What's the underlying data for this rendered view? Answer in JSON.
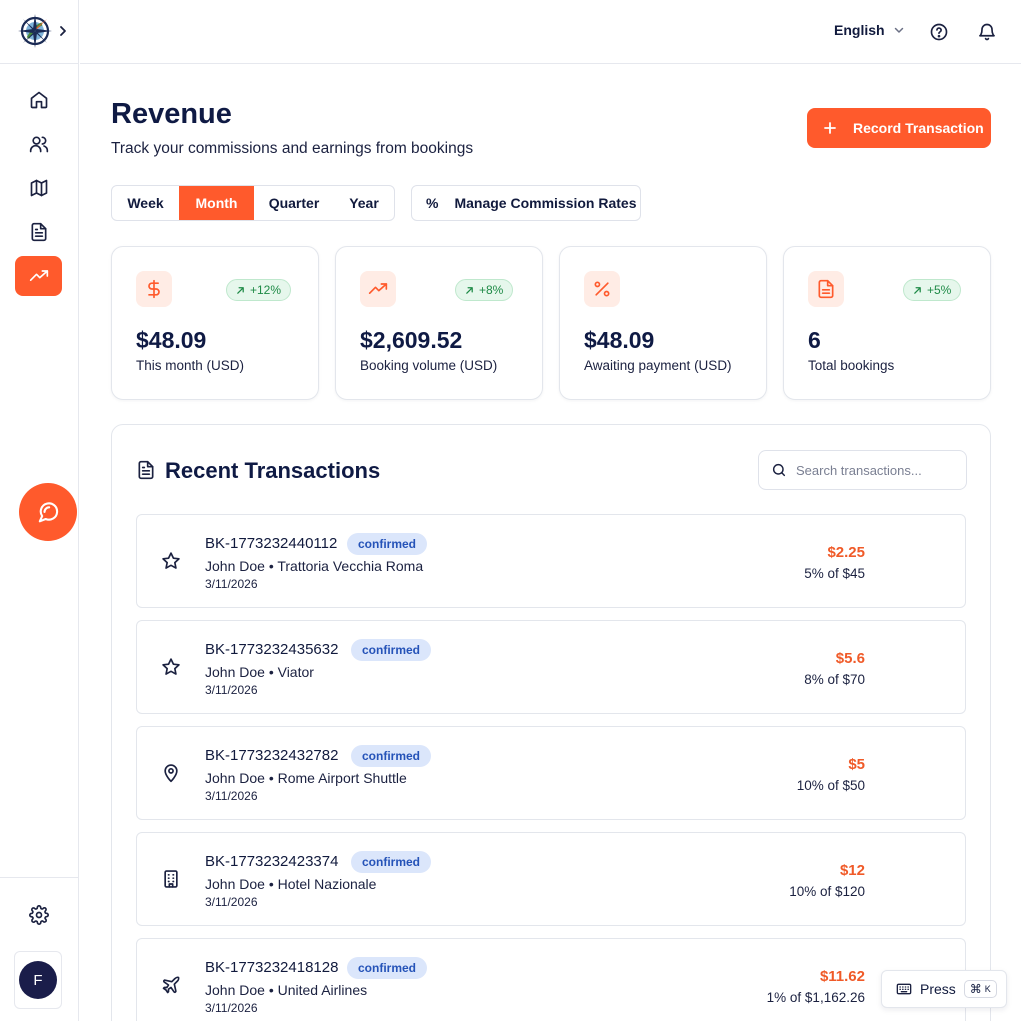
{
  "topbar": {
    "language": "English"
  },
  "header": {
    "title": "Revenue",
    "subtitle": "Track your commissions and earnings from bookings",
    "record_button": "Record Transaction"
  },
  "period_tabs": [
    {
      "label": "Week",
      "active": false
    },
    {
      "label": "Month",
      "active": true
    },
    {
      "label": "Quarter",
      "active": false
    },
    {
      "label": "Year",
      "active": false
    }
  ],
  "manage_button": {
    "icon_glyph": "%",
    "label": "Manage Commission Rates"
  },
  "stats": [
    {
      "icon": "dollar-icon",
      "badge": "+12%",
      "value": "$48.09",
      "label": "This month (USD)"
    },
    {
      "icon": "trending-up-icon",
      "badge": "+8%",
      "value": "$2,609.52",
      "label": "Booking volume (USD)"
    },
    {
      "icon": "percent-icon",
      "badge": "",
      "value": "$48.09",
      "label": "Awaiting payment (USD)"
    },
    {
      "icon": "document-icon",
      "badge": "+5%",
      "value": "6",
      "label": "Total bookings"
    }
  ],
  "transactions": {
    "title": "Recent Transactions",
    "search_placeholder": "Search transactions...",
    "rows": [
      {
        "icon": "star-icon",
        "id": "BK-1773232440112",
        "status": "confirmed",
        "desc": "John Doe • Trattoria Vecchia Roma",
        "date": "3/11/2026",
        "amount": "$2.25",
        "rate": "5% of $45"
      },
      {
        "icon": "star-icon",
        "id": "BK-1773232435632",
        "status": "confirmed",
        "desc": "John Doe • Viator",
        "date": "3/11/2026",
        "amount": "$5.6",
        "rate": "8% of $70"
      },
      {
        "icon": "map-pin-icon",
        "id": "BK-1773232432782",
        "status": "confirmed",
        "desc": "John Doe • Rome Airport Shuttle",
        "date": "3/11/2026",
        "amount": "$5",
        "rate": "10% of $50"
      },
      {
        "icon": "building-icon",
        "id": "BK-1773232423374",
        "status": "confirmed",
        "desc": "John Doe • Hotel Nazionale",
        "date": "3/11/2026",
        "amount": "$12",
        "rate": "10% of $120"
      },
      {
        "icon": "plane-icon",
        "id": "BK-1773232418128",
        "status": "confirmed",
        "desc": "John Doe • United Airlines",
        "date": "3/11/2026",
        "amount": "$11.62",
        "rate": "1% of $1,162.26"
      }
    ]
  },
  "user": {
    "initial": "F"
  },
  "shortcut_hint": {
    "label": "Press",
    "key_symbol": "⌘",
    "key": "K"
  },
  "colors": {
    "accent": "#ff5a2c",
    "navy": "#0f1a44",
    "success": "#1e8a46",
    "status_blue": "#2553b8"
  }
}
